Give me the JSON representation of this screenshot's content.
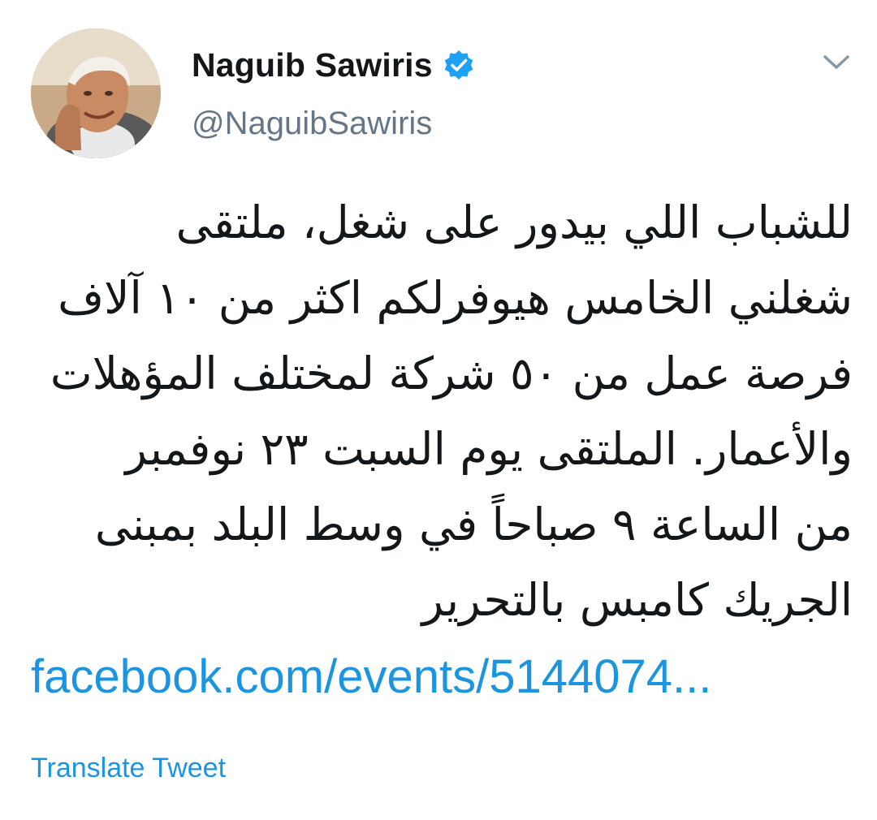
{
  "author": {
    "display_name": "Naguib Sawiris",
    "handle": "@NaguibSawiris",
    "verified": true,
    "avatar_icon": "profile-photo"
  },
  "menu": {
    "icon": "chevron-down-icon"
  },
  "tweet": {
    "lines": [
      "للشباب اللي بيدور على شغل، ملتقى",
      "شغلني الخامس هيوفرلكم اكثر من ١٠ آلاف",
      "فرصة عمل من ٥٠ شركة لمختلف المؤهلات",
      "والأعمار. الملتقى يوم السبت ٢٣ نوفمبر",
      "من الساعة ٩ صباحاً في وسط البلد بمبنى",
      "الجريك كامبس بالتحرير"
    ],
    "link_text": "facebook.com/events/5144074...",
    "translate_label": "Translate Tweet"
  },
  "colors": {
    "link": "#1b95e0",
    "verified": "#1da1f2",
    "secondary_text": "#657786",
    "primary_text": "#14171a"
  }
}
